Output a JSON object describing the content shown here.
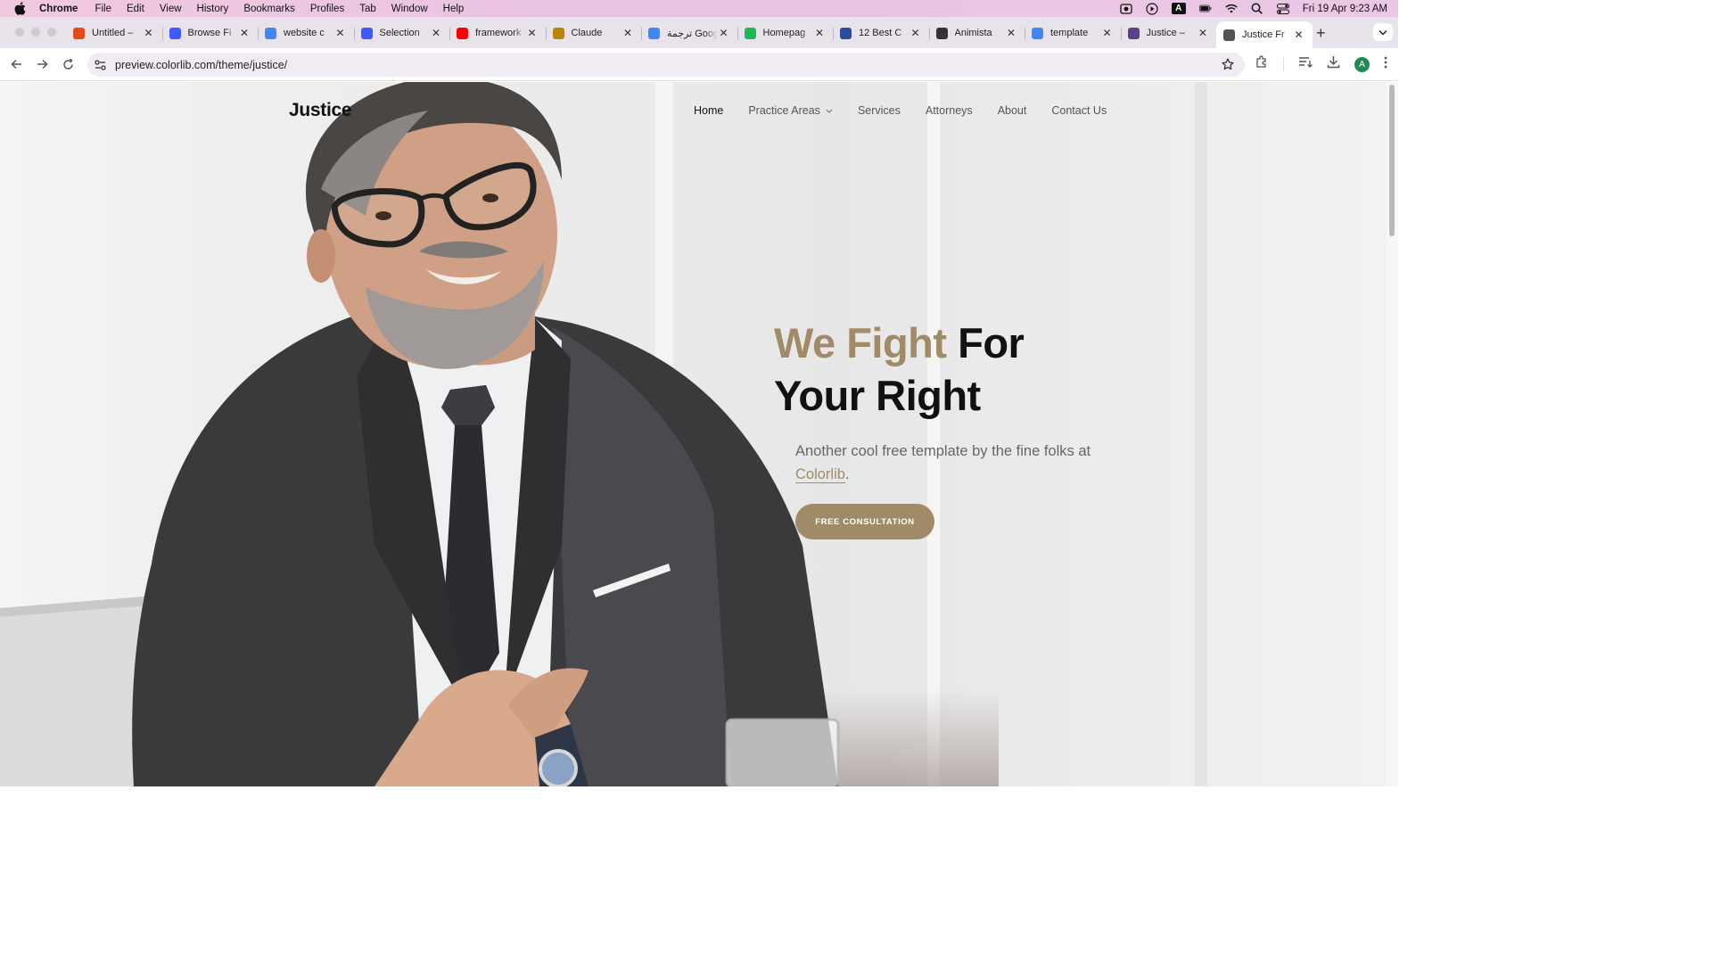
{
  "menubar": {
    "items": [
      "Chrome",
      "File",
      "Edit",
      "View",
      "History",
      "Bookmarks",
      "Profiles",
      "Tab",
      "Window",
      "Help"
    ],
    "status_letter": "A",
    "clock": "Fri 19 Apr  9:23 AM"
  },
  "tabs": [
    {
      "label": "Untitled –",
      "icon": "figma-icon",
      "color": "#e64a19",
      "active": false
    },
    {
      "label": "Browse Fi",
      "icon": "app-icon",
      "color": "#3d5afe",
      "active": false
    },
    {
      "label": "website c",
      "icon": "google-icon",
      "color": "#4285f4",
      "active": false
    },
    {
      "label": "Selection",
      "icon": "app-icon",
      "color": "#3d5afe",
      "active": false
    },
    {
      "label": "framework",
      "icon": "youtube-icon",
      "color": "#ff0000",
      "active": false
    },
    {
      "label": "Claude",
      "icon": "claude-icon",
      "color": "#b8860b",
      "active": false
    },
    {
      "label": "ترجمة Google",
      "icon": "translate-icon",
      "color": "#4285f4",
      "active": false
    },
    {
      "label": "Homepag",
      "icon": "app-icon",
      "color": "#1db954",
      "active": false
    },
    {
      "label": "12 Best C",
      "icon": "app-icon",
      "color": "#2b4c9b",
      "active": false
    },
    {
      "label": "Animista",
      "icon": "app-icon",
      "color": "#333333",
      "active": false
    },
    {
      "label": "template",
      "icon": "google-icon",
      "color": "#4285f4",
      "active": false
    },
    {
      "label": "Justice – ",
      "icon": "app-icon",
      "color": "#5b3f8c",
      "active": false
    },
    {
      "label": "Justice Fr",
      "icon": "globe-icon",
      "color": "#555555",
      "active": true
    }
  ],
  "address": {
    "url": "preview.colorlib.com/theme/justice/",
    "profile_initial": "A"
  },
  "site": {
    "logo": "Justice",
    "nav": [
      {
        "label": "Home",
        "active": true
      },
      {
        "label": "Practice Areas",
        "dropdown": true
      },
      {
        "label": "Services"
      },
      {
        "label": "Attorneys"
      },
      {
        "label": "About"
      },
      {
        "label": "Contact Us"
      }
    ],
    "hero": {
      "title_accent": "We Fight",
      "title_rest_1": "For",
      "title_rest_2": "Your Right",
      "subtitle_pre": "Another cool free template by the fine folks at ",
      "subtitle_link": "Colorlib",
      "subtitle_post": ".",
      "cta": "FREE CONSULTATION"
    }
  },
  "colors": {
    "accent": "#a08a67",
    "text_dark": "#111111",
    "text_muted": "#666666"
  }
}
